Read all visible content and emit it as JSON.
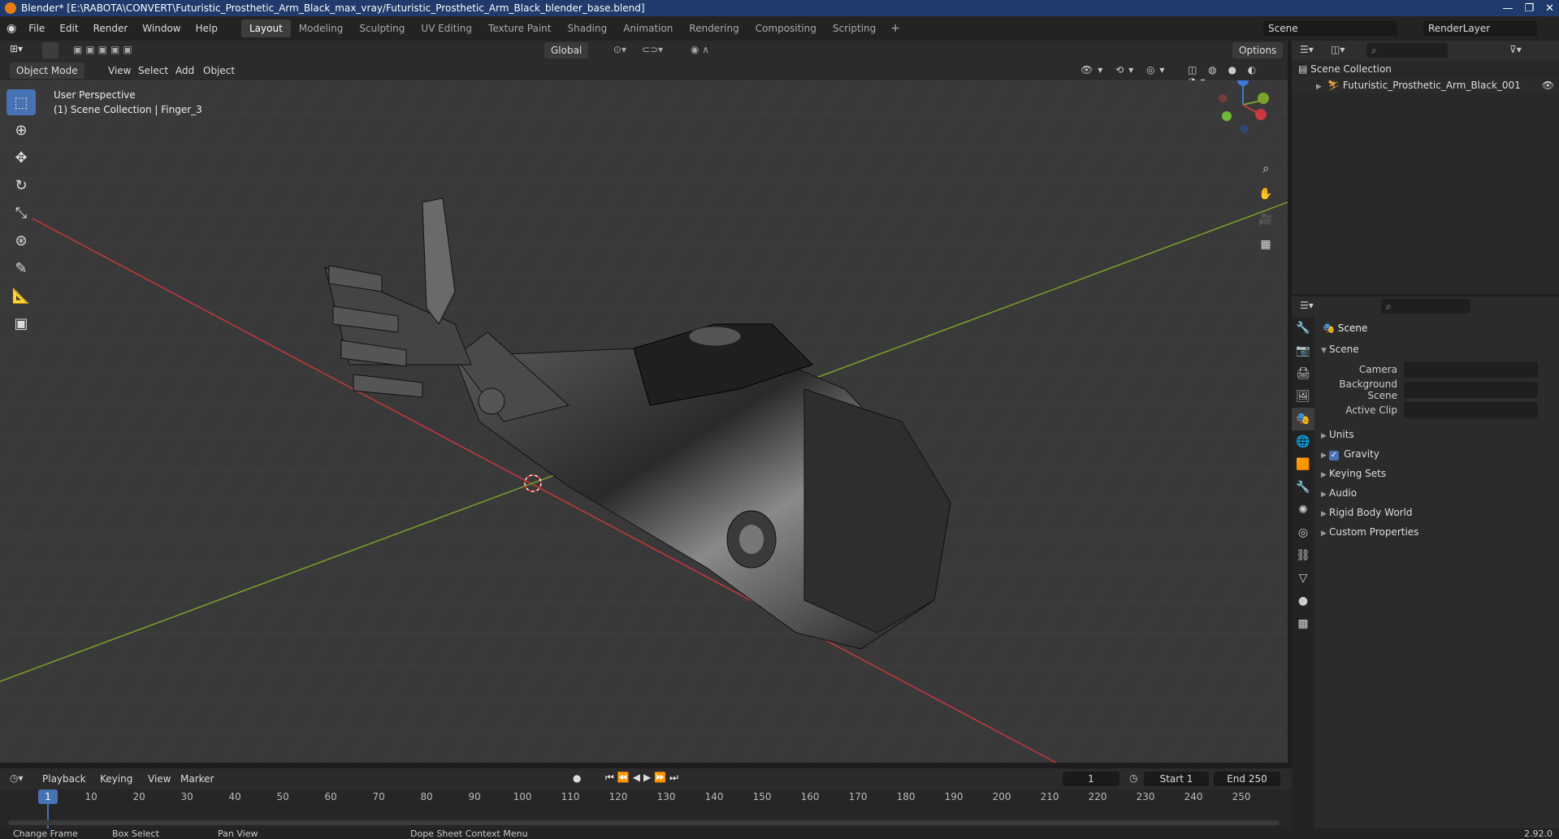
{
  "window": {
    "title": "Blender* [E:\\RABOTA\\CONVERT\\Futuristic_Prosthetic_Arm_Black_max_vray/Futuristic_Prosthetic_Arm_Black_blender_base.blend]"
  },
  "menu": [
    "File",
    "Edit",
    "Render",
    "Window",
    "Help"
  ],
  "workspaces": [
    "Layout",
    "Modeling",
    "Sculpting",
    "UV Editing",
    "Texture Paint",
    "Shading",
    "Animation",
    "Rendering",
    "Compositing",
    "Scripting"
  ],
  "active_workspace": "Layout",
  "scene_name": "Scene",
  "render_layer": "RenderLayer",
  "toolbar": {
    "transform": "Global",
    "options": "Options"
  },
  "viewport_header": {
    "mode": "Object Mode",
    "items": [
      "View",
      "Select",
      "Add",
      "Object"
    ]
  },
  "viewport_info": {
    "perspective": "User Perspective",
    "collection": "(1) Scene Collection | Finger_3"
  },
  "gizmo": {
    "x": "X",
    "y": "Y",
    "z": "Z"
  },
  "outliner": {
    "root": "Scene Collection",
    "object": "Futuristic_Prosthetic_Arm_Black_001"
  },
  "properties": {
    "header": "Scene",
    "section": "Scene",
    "fields": [
      {
        "label": "Camera"
      },
      {
        "label": "Background Scene"
      },
      {
        "label": "Active Clip"
      }
    ],
    "subsections": [
      "Units",
      "Gravity",
      "Keying Sets",
      "Audio",
      "Rigid Body World",
      "Custom Properties"
    ],
    "gravity_checked": true
  },
  "timeline": {
    "menus": [
      "Playback",
      "Keying",
      "View",
      "Marker"
    ],
    "current_frame": "1",
    "start_label": "Start",
    "start": "1",
    "end_label": "End",
    "end": "250",
    "ticks": [
      "1",
      "10",
      "20",
      "30",
      "40",
      "50",
      "60",
      "70",
      "80",
      "90",
      "100",
      "110",
      "120",
      "130",
      "140",
      "150",
      "160",
      "170",
      "180",
      "190",
      "200",
      "210",
      "220",
      "230",
      "240",
      "250"
    ]
  },
  "statusbar": {
    "items": [
      "Change Frame",
      "Box Select",
      "Pan View",
      "Dope Sheet Context Menu"
    ],
    "version": "2.92.0"
  },
  "colors": {
    "accent": "#4772b3",
    "x_axis": "#c8383f",
    "y_axis": "#7aa32a"
  }
}
